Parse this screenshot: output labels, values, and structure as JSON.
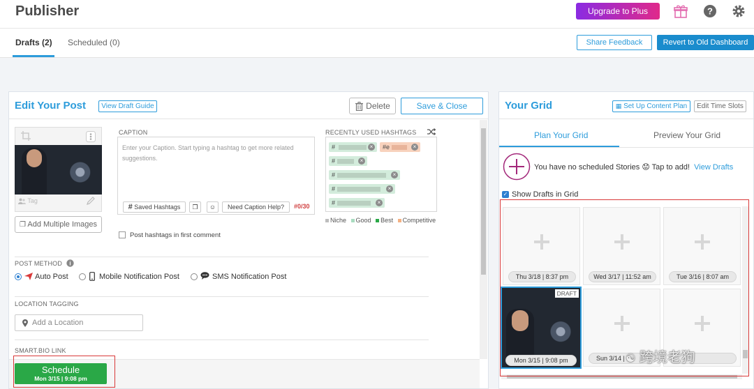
{
  "app": {
    "title": "Publisher"
  },
  "header": {
    "upgrade_label": "Upgrade to Plus"
  },
  "tabs": [
    {
      "label": "Drafts (2)"
    },
    {
      "label": "Scheduled (0)"
    }
  ],
  "actions": {
    "share_feedback": "Share Feedback",
    "revert": "Revert to Old Dashboard"
  },
  "edit_post": {
    "title": "Edit Your Post",
    "view_guide": "View Draft Guide",
    "delete_label": "Delete",
    "save_close_label": "Save & Close",
    "tag_label": "Tag",
    "add_multiple_images": "Add Multiple Images",
    "caption_label": "CAPTION",
    "caption_placeholder": "Enter your Caption. Start typing a hashtag to get more related suggestions.",
    "saved_hashtags": "Saved Hashtags",
    "need_caption_help": "Need Caption Help?",
    "hashtag_counter": "#0/30",
    "recent_hashtags_label": "RECENTLY USED HASHTAGS",
    "hashtags": [
      "#",
      "#e",
      "#",
      "#",
      "#",
      "#"
    ],
    "legend": [
      "Niche",
      "Good",
      "Best",
      "Competitive"
    ],
    "legend_colors": [
      "#bdbdbd",
      "#a9dcc0",
      "#2aa847",
      "#f4b183"
    ],
    "post_hashtags_first_comment": "Post hashtags in first comment",
    "post_method_label": "POST METHOD",
    "post_methods": [
      "Auto Post",
      "Mobile Notification Post",
      "SMS Notification Post"
    ],
    "location_label": "LOCATION TAGGING",
    "location_placeholder": "Add a Location",
    "smart_bio_label": "SMART.BIO LINK",
    "schedule_label": "Schedule",
    "schedule_time": "Mon 3/15 | 9:08 pm"
  },
  "grid": {
    "title": "Your Grid",
    "setup_content_plan": "Set Up Content Plan",
    "edit_time_slots": "Edit Time Slots",
    "tab_plan": "Plan Your Grid",
    "tab_preview": "Preview Your Grid",
    "stories_text": "You have no scheduled Stories",
    "stories_emoji": "😟",
    "tap_to_add": "Tap to add!",
    "view_drafts": "View Drafts",
    "show_drafts": "Show Drafts in Grid",
    "draft_badge": "DRAFT",
    "slots": [
      "Thu 3/18 | 8:37 pm",
      "Wed 3/17 | 11:52 am",
      "Tue 3/16 | 8:07 am",
      "Mon 3/15 | 9:08 pm",
      "Sun 3/14 |",
      ""
    ]
  },
  "watermark": "跨境老狗",
  "colors": {
    "accent": "#2d9cdb",
    "schedule_green": "#2aa847",
    "highlight_red": "#d93939"
  }
}
